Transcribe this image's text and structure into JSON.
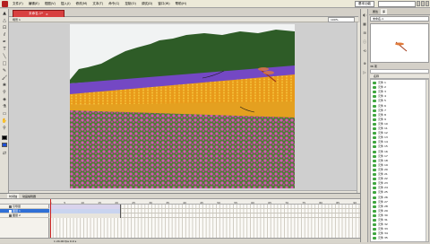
{
  "app": {
    "menus": [
      "Fl",
      "文件(F)",
      "编辑(E)",
      "视图(V)",
      "插入(I)",
      "修改(M)",
      "文本(T)",
      "命令(C)",
      "控制(O)",
      "调试(D)",
      "窗口(W)",
      "帮助(H)"
    ],
    "workspace_label": "基本功能",
    "window_buttons": [
      "minimize",
      "maximize",
      "close"
    ]
  },
  "document": {
    "tab_title": "未命名-1*",
    "tab_close": "×",
    "scene_label": "场景 1",
    "zoom": "100%"
  },
  "tools": [
    "arrow-icon",
    "subselect-icon",
    "transform-icon",
    "lasso-icon",
    "pen-icon",
    "text-icon",
    "line-icon",
    "rect-icon",
    "pencil-icon",
    "brush-icon",
    "deco-icon",
    "bone-icon",
    "bucket-icon",
    "eyedropper-icon",
    "eraser-icon",
    "hand-icon",
    "zoom-icon"
  ],
  "stage": {
    "image_description_colors": {
      "sky": "#f2f4f4",
      "trees": "#2f5f2a",
      "lavender": "#7a4ec8",
      "marigold": "#f0a020",
      "pink_flowers": "#c84ea8",
      "foliage": "#3f7a32"
    }
  },
  "timeline": {
    "tabs": [
      "时间轴",
      "动画编辑器"
    ],
    "layers": [
      {
        "name": "引导层",
        "selected": false
      },
      {
        "name": "图层 1",
        "selected": true
      },
      {
        "name": "图层 2",
        "selected": false
      }
    ],
    "ruler_ticks": [
      "1",
      "5",
      "10",
      "15",
      "20",
      "25",
      "30",
      "35",
      "40",
      "45",
      "50",
      "55",
      "60",
      "65",
      "70",
      "75",
      "80",
      "85",
      "90"
    ],
    "footer": "1  24.00 fps  0.0 s"
  },
  "library": {
    "tabs": [
      "属性",
      "库"
    ],
    "doc_name": "未命名-1",
    "count": "36 项",
    "column_header": "名称",
    "items": [
      "元件 1",
      "元件 2",
      "元件 3",
      "元件 4",
      "元件 5",
      "元件 6",
      "元件 7",
      "元件 8",
      "元件 9",
      "元件 10",
      "元件 11",
      "元件 12",
      "元件 13",
      "元件 14",
      "元件 15",
      "元件 16",
      "元件 17",
      "元件 18",
      "元件 19",
      "元件 20",
      "元件 21",
      "元件 22",
      "元件 23",
      "元件 24",
      "元件 25",
      "元件 26",
      "元件 27",
      "元件 28",
      "元件 29",
      "元件 30",
      "元件 31",
      "元件 32",
      "元件 33",
      "元件 34",
      "元件 35"
    ]
  }
}
